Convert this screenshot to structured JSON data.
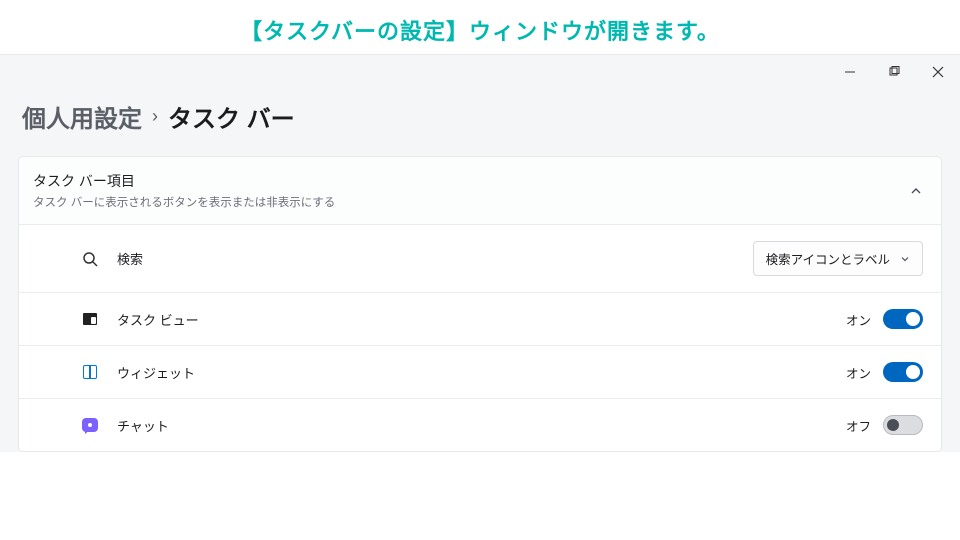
{
  "caption": "【タスクバーの設定】ウィンドウが開きます。",
  "breadcrumb": {
    "parent": "個人用設定",
    "current": "タスク バー"
  },
  "section": {
    "title": "タスク バー項目",
    "subtitle": "タスク バーに表示されるボタンを表示または非表示にする"
  },
  "rows": {
    "search": {
      "label": "検索",
      "dropdown": "検索アイコンとラベル"
    },
    "taskview": {
      "label": "タスク ビュー",
      "state": "オン"
    },
    "widgets": {
      "label": "ウィジェット",
      "state": "オン"
    },
    "chat": {
      "label": "チャット",
      "state": "オフ"
    }
  }
}
